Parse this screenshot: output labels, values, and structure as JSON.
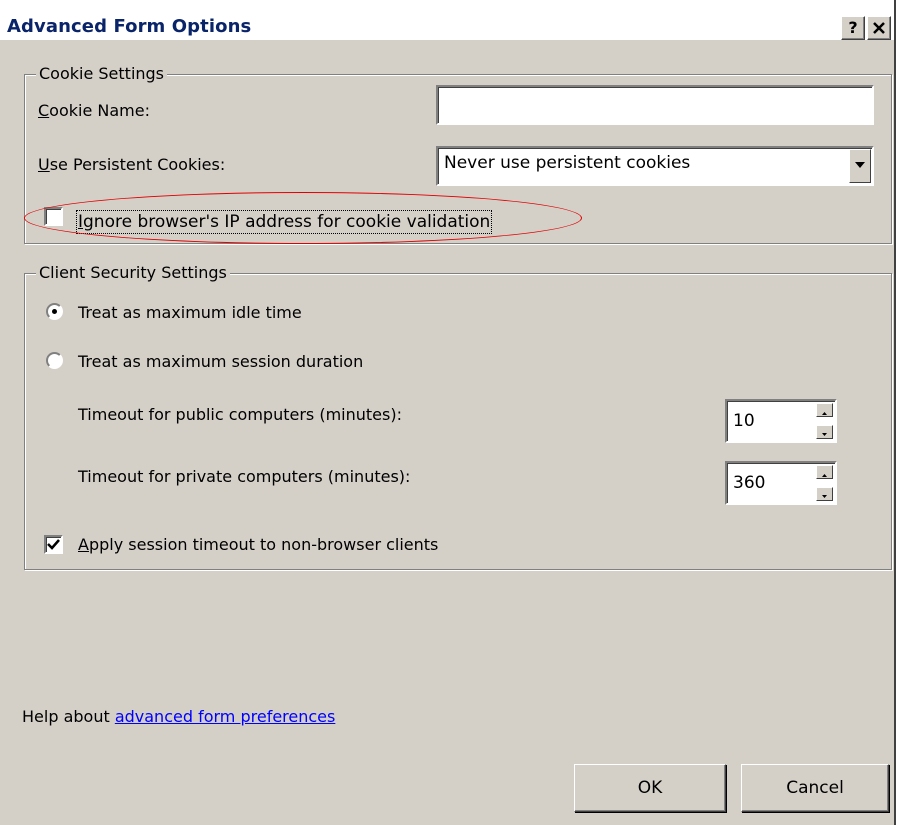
{
  "dialog": {
    "title": "Advanced Form Options",
    "help_icon": "?",
    "close_icon": "x"
  },
  "cookie_settings": {
    "legend": "Cookie Settings",
    "cookie_name_label": "Cookie Name:",
    "cookie_name_value": "",
    "persistent_label": "Use Persistent Cookies:",
    "persistent_value": "Never use persistent cookies",
    "ignore_ip_label": "Ignore browser's IP address for cookie validation",
    "ignore_ip_checked": false
  },
  "client_security": {
    "legend": "Client Security Settings",
    "radio_idle_label": "Treat as maximum idle time",
    "radio_session_label": "Treat as maximum session duration",
    "selected_radio": "idle",
    "public_timeout_label": "Timeout for public computers (minutes):",
    "public_timeout_value": "10",
    "private_timeout_label": "Timeout for private computers (minutes):",
    "private_timeout_value": "360",
    "apply_timeout_label": "Apply session timeout to non-browser clients",
    "apply_timeout_checked": true
  },
  "help": {
    "prefix": "Help about ",
    "link_text": "advanced form preferences"
  },
  "buttons": {
    "ok": "OK",
    "cancel": "Cancel"
  },
  "colors": {
    "title_text": "#0a246a",
    "dialog_bg": "#d4d0c8",
    "link": "#0000ff",
    "annotation": "#e00000"
  }
}
